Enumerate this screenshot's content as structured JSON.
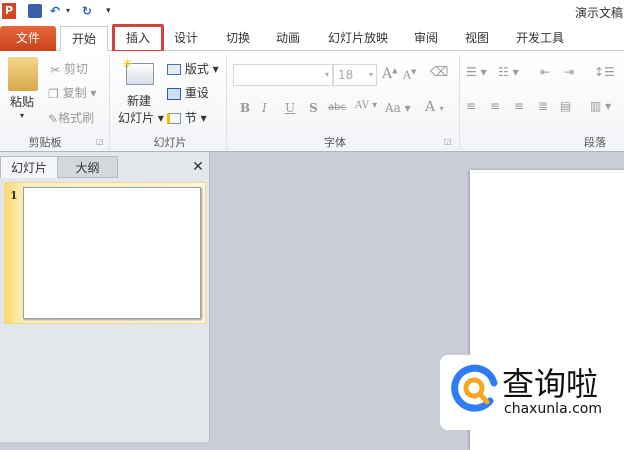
{
  "window": {
    "title": "演示文稿"
  },
  "quick_access": {
    "app_icon": "P",
    "save": "save-icon",
    "undo": "undo-icon",
    "redo": "redo-icon",
    "customize": "customize-icon"
  },
  "tabs": [
    {
      "label": "文件"
    },
    {
      "label": "开始"
    },
    {
      "label": "插入"
    },
    {
      "label": "设计"
    },
    {
      "label": "切换"
    },
    {
      "label": "动画"
    },
    {
      "label": "幻灯片放映"
    },
    {
      "label": "审阅"
    },
    {
      "label": "视图"
    },
    {
      "label": "开发工具"
    }
  ],
  "ribbon": {
    "clipboard": {
      "label": "剪贴板",
      "paste": "粘贴",
      "cut": "剪切",
      "copy": "复制",
      "format_painter": "格式刷"
    },
    "slides": {
      "label": "幻灯片",
      "new_slide_1": "新建",
      "new_slide_2": "幻灯片",
      "layout": "版式",
      "reset": "重设",
      "section": "节"
    },
    "font": {
      "label": "字体",
      "font_name": "",
      "font_size": "18",
      "grow": "A",
      "shrink": "A",
      "bold": "B",
      "italic": "I",
      "underline": "U",
      "shadow": "S",
      "strike": "abc",
      "spacing": "AV",
      "case": "Aa",
      "color": "A"
    },
    "paragraph": {
      "label": "段落"
    }
  },
  "pane": {
    "tab_slides": "幻灯片",
    "tab_outline": "大纲",
    "close": "✕",
    "slide_number": "1"
  },
  "watermark": {
    "name": "查询啦",
    "url": "chaxunla.com"
  },
  "colors": {
    "file_tab": "#d5512a",
    "highlight": "#d2433f",
    "logo_blue": "#2f7cf6",
    "logo_orange": "#f5a623"
  }
}
